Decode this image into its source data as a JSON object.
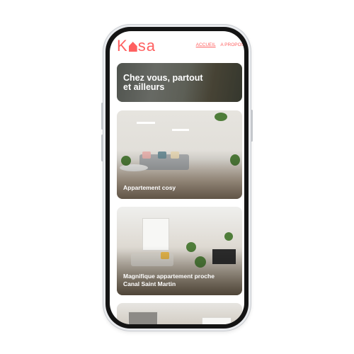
{
  "app": {
    "logo": {
      "prefix": "K",
      "suffix": "sa",
      "icon": "home-icon"
    },
    "nav": [
      {
        "label": "ACCUEIL",
        "active": true
      },
      {
        "label": "A PROPOS",
        "active": false
      }
    ],
    "accent_color": "#ff6060"
  },
  "banner": {
    "title_line1": "Chez vous, partout",
    "title_line2": "et ailleurs"
  },
  "cards": [
    {
      "title_line1": "Appartement cosy",
      "title_line2": ""
    },
    {
      "title_line1": "Magnifique appartement proche",
      "title_line2": "Canal Saint Martin"
    },
    {
      "title_line1": "",
      "title_line2": ""
    }
  ]
}
